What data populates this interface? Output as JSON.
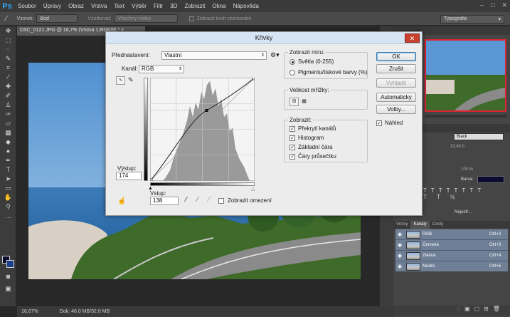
{
  "app": {
    "logo": "Ps",
    "menu": [
      "Soubor",
      "Úpravy",
      "Obraz",
      "Vrstva",
      "Text",
      "Výběr",
      "Filtr",
      "3D",
      "Zobrazit",
      "Okna",
      "Nápověda"
    ],
    "window_controls": [
      "–",
      "□",
      "✕"
    ]
  },
  "options_bar": {
    "sample_label": "Vzorek:",
    "sample_value": "Bod",
    "sample_layers_label": "Vzorkovat:",
    "sample_layers_value": "Všechny vrstvy",
    "show_ring_label": "Zobrazit kruh vzorkování",
    "workspace": "Typografie"
  },
  "document": {
    "tab_title": "DSC_0121.JPG @ 16,7% (Vrstva 1,RGB/8) *",
    "zoom": "16,67%",
    "doc_size": "Dok: 46,0 MB/92,0 MB"
  },
  "dialog": {
    "title": "Křivky",
    "preset_label": "Přednastavení:",
    "preset_value": "Vlastní",
    "channel_label": "Kanál:",
    "channel_value": "RGB",
    "output_label": "Výstup:",
    "output_value": "174",
    "input_label": "Vstup:",
    "input_value": "138",
    "show_clipping_label": "Zobrazit omezení",
    "show_amount": {
      "title": "Zobrazit míru:",
      "light_label": "Světla (0-255)",
      "pigment_label": "Pigmentu/tiskové barvy (%)"
    },
    "grid_size": {
      "title": "Velikost mřížky:"
    },
    "show": {
      "title": "Zobrazit:",
      "overlay_label": "Překrytí kanálů",
      "histogram_label": "Histogram",
      "baseline_label": "Základní čára",
      "intersection_label": "Čáry průsečíku"
    },
    "buttons": {
      "ok": "OK",
      "cancel": "Zrušit",
      "smooth": "Vyhladit",
      "auto": "Automaticky",
      "options": "Volby..."
    },
    "preview_label": "Náhled",
    "curve_point": {
      "input": 138,
      "output": 174
    }
  },
  "panels": {
    "tabs": [
      "Vrstvy",
      "Kanály",
      "Cesty"
    ],
    "channels": [
      {
        "name": "RGB",
        "key": "Ctrl+2"
      },
      {
        "name": "Červená",
        "key": "Ctrl+3"
      },
      {
        "name": "Zelená",
        "key": "Ctrl+4"
      },
      {
        "name": "Modrá",
        "key": "Ctrl+5"
      }
    ],
    "char_color_label": "Barva:",
    "font_style": "Black",
    "size_value": "10,45 b",
    "percent_value": "100 %",
    "aa_value": "Nejostř..."
  }
}
